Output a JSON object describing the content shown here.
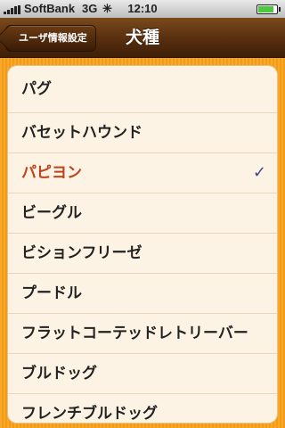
{
  "status_bar": {
    "carrier": "SoftBank",
    "network": "3G",
    "time": "12:10"
  },
  "nav": {
    "back_label": "ユーザ情報設定",
    "title": "犬種"
  },
  "breeds": [
    {
      "label": "パグ",
      "selected": false
    },
    {
      "label": "バセットハウンド",
      "selected": false
    },
    {
      "label": "パピヨン",
      "selected": true
    },
    {
      "label": "ビーグル",
      "selected": false
    },
    {
      "label": "ビションフリーゼ",
      "selected": false
    },
    {
      "label": "プードル",
      "selected": false
    },
    {
      "label": "フラットコーテッドレトリーバー",
      "selected": false
    },
    {
      "label": "ブルドッグ",
      "selected": false
    },
    {
      "label": "フレンチブルドッグ",
      "selected": false
    }
  ],
  "colors": {
    "selected_text": "#c0421c",
    "checkmark": "#3a4a8a",
    "navbar": "#5a3010",
    "background": "#f7a21c"
  }
}
